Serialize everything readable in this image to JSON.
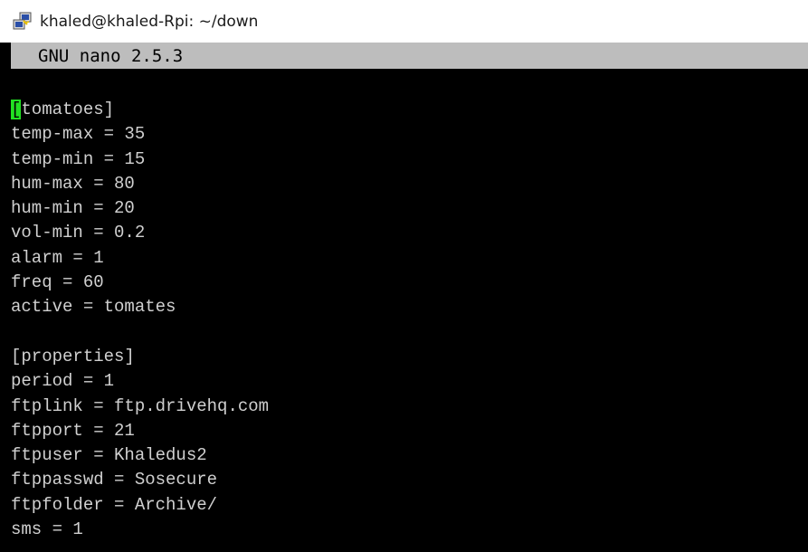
{
  "window": {
    "title": "khaled@khaled-Rpi: ~/down",
    "icon": "putty-icon"
  },
  "editor": {
    "header": "GNU nano 2.5.3",
    "cursor_char": "[",
    "lines": [
      "",
      "tomatoes]",
      "temp-max = 35",
      "temp-min = 15",
      "hum-max = 80",
      "hum-min = 20",
      "vol-min = 0.2",
      "alarm = 1",
      "freq = 60",
      "active = tomates",
      "",
      "[properties]",
      "period = 1",
      "ftplink = ftp.drivehq.com",
      "ftpport = 21",
      "ftpuser = Khaledus2",
      "ftppasswd = Sosecure",
      "ftpfolder = Archive/",
      "sms = 1"
    ]
  }
}
